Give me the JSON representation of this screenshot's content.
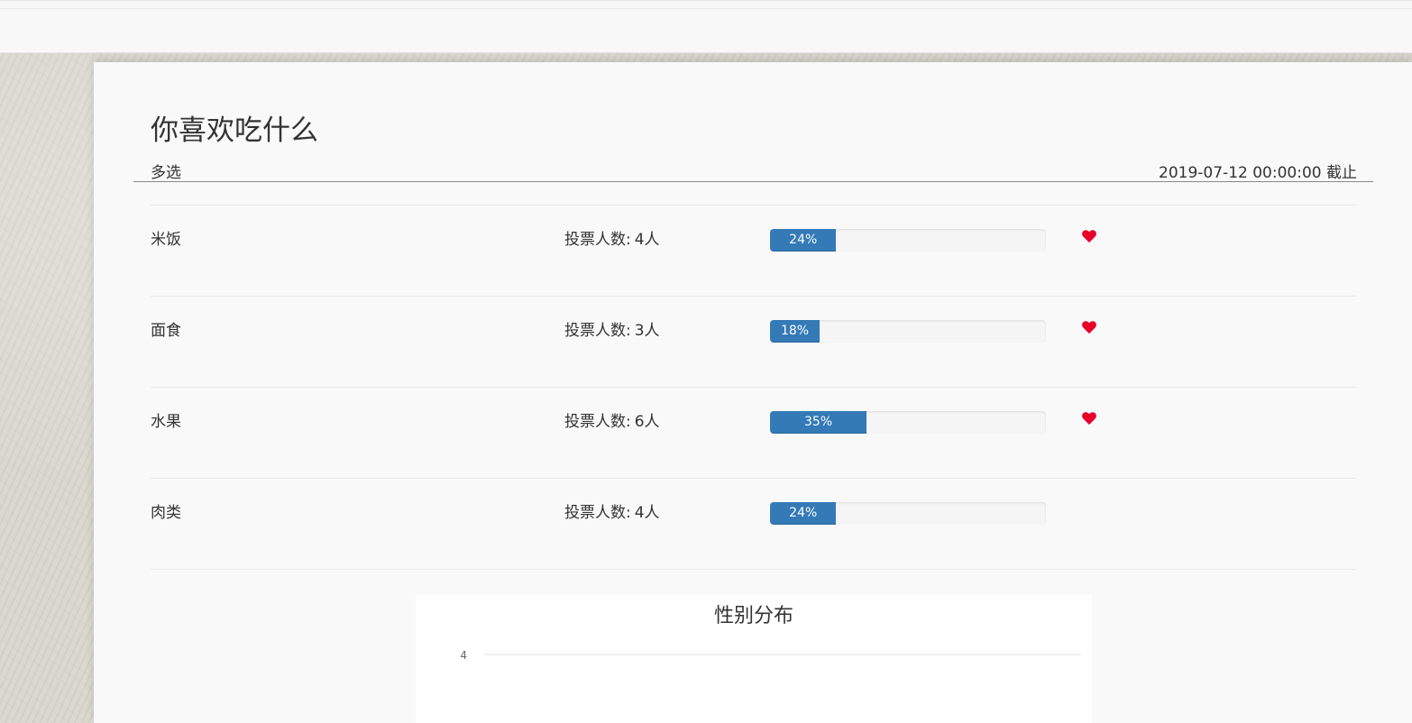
{
  "vote": {
    "title": "你喜欢吃什么",
    "type": "多选",
    "deadline": "2019-07-12 00:00:00 截止"
  },
  "colors": {
    "progress": "#337ab7",
    "heart": "#e8002a"
  },
  "options": [
    {
      "name": "米饭",
      "count_label": "投票人数:",
      "count": "4人",
      "percent_label": "24%",
      "percent": 24,
      "liked": true
    },
    {
      "name": "面食",
      "count_label": "投票人数:",
      "count": "3人",
      "percent_label": "18%",
      "percent": 18,
      "liked": true
    },
    {
      "name": "水果",
      "count_label": "投票人数:",
      "count": "6人",
      "percent_label": "35%",
      "percent": 35,
      "liked": true
    },
    {
      "name": "肉类",
      "count_label": "投票人数:",
      "count": "4人",
      "percent_label": "24%",
      "percent": 24,
      "liked": false
    }
  ],
  "chart_data": {
    "type": "bar",
    "title": "性别分布",
    "ytick_labels": [
      "4"
    ],
    "grid": true
  }
}
